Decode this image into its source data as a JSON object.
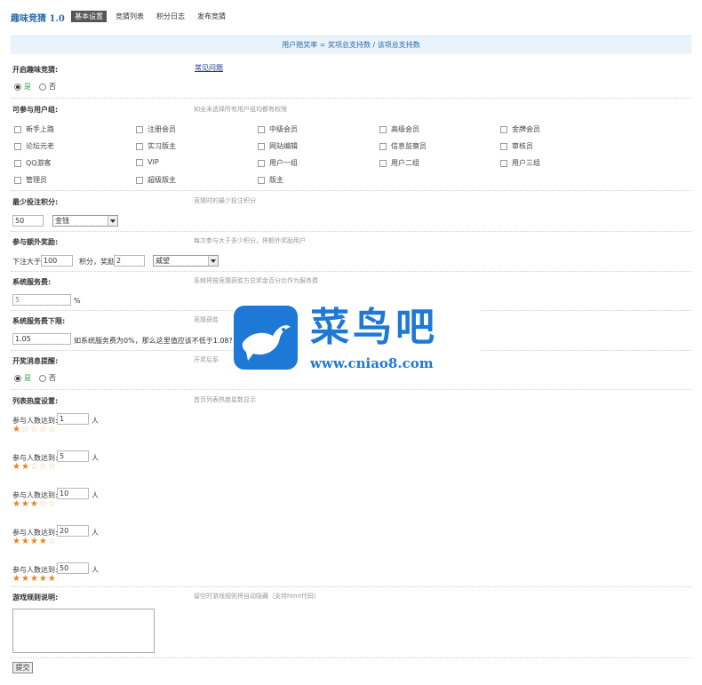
{
  "app": {
    "title": "趣味竞猜 1.0"
  },
  "nav": {
    "tabs": [
      {
        "label": "基本设置",
        "active": true
      },
      {
        "label": "竞猜列表"
      },
      {
        "label": "积分日志"
      },
      {
        "label": "发布竞猜"
      }
    ]
  },
  "banner": {
    "text": "用户赔奖率 = 奖项总支持数 / 该项总支持数"
  },
  "enable": {
    "label": "开启趣味竞猜:",
    "link": "常见问题",
    "options": [
      "是",
      "否"
    ],
    "selected": "是"
  },
  "usergroups": {
    "label": "可参与用户组:",
    "desc": "如全未选择所有用户组均都有权限",
    "items": [
      "新手上路",
      "注册会员",
      "中级会员",
      "高级会员",
      "金牌会员",
      "论坛元老",
      "实习版主",
      "网站编辑",
      "信息监察员",
      "审核员",
      "QQ游客",
      "VIP",
      "用户一组",
      "用户二组",
      "用户三组",
      "管理员",
      "超级版主",
      "版主"
    ]
  },
  "min_bet": {
    "label": "最少投注积分:",
    "desc": "竞猜时的最少投注积分",
    "value": "50",
    "currency": "金钱"
  },
  "extra_reward": {
    "label": "参与额外奖励:",
    "desc": "每次参与大于多少积分，将额外奖励用户",
    "prefix": "下注大于",
    "amount": "100",
    "middle": "积分，奖励",
    "reward": "2",
    "currency": "威望"
  },
  "service_fee": {
    "label": "系统服务费:",
    "desc": "系统将按竞猜获胜方总奖金百分比作为服务费",
    "value": "5",
    "unit": "%"
  },
  "fee_floor": {
    "label": "系统服务费下限:",
    "desc": "竞猜获胜",
    "value": "1.05",
    "note": "如系统服务费为0%，那么这里值应该不低于1.08?"
  },
  "notify": {
    "label": "开奖消息提醒:",
    "desc": "开奖后系",
    "options": [
      "是",
      "否"
    ],
    "selected": "是"
  },
  "hot": {
    "label": "列表热度设置:",
    "desc": "首页列表热度星数显示",
    "prefix": "参与人数达到:",
    "unit": "人",
    "levels": [
      {
        "count": "1",
        "stars": 1
      },
      {
        "count": "5",
        "stars": 2
      },
      {
        "count": "10",
        "stars": 3
      },
      {
        "count": "20",
        "stars": 4
      },
      {
        "count": "50",
        "stars": 5
      }
    ]
  },
  "rules": {
    "label": "游戏规则说明:",
    "desc": "留空时游戏规则将自动隐藏（支持html代码）"
  },
  "submit": {
    "label": "提交"
  },
  "watermark": {
    "name": "菜鸟吧",
    "url": "www.cniao8.com"
  },
  "colors": {
    "accent": "#2b6cab",
    "banner_bg": "#e8f3fc",
    "star": "#e8861c",
    "watermark": "#1d78d6"
  }
}
